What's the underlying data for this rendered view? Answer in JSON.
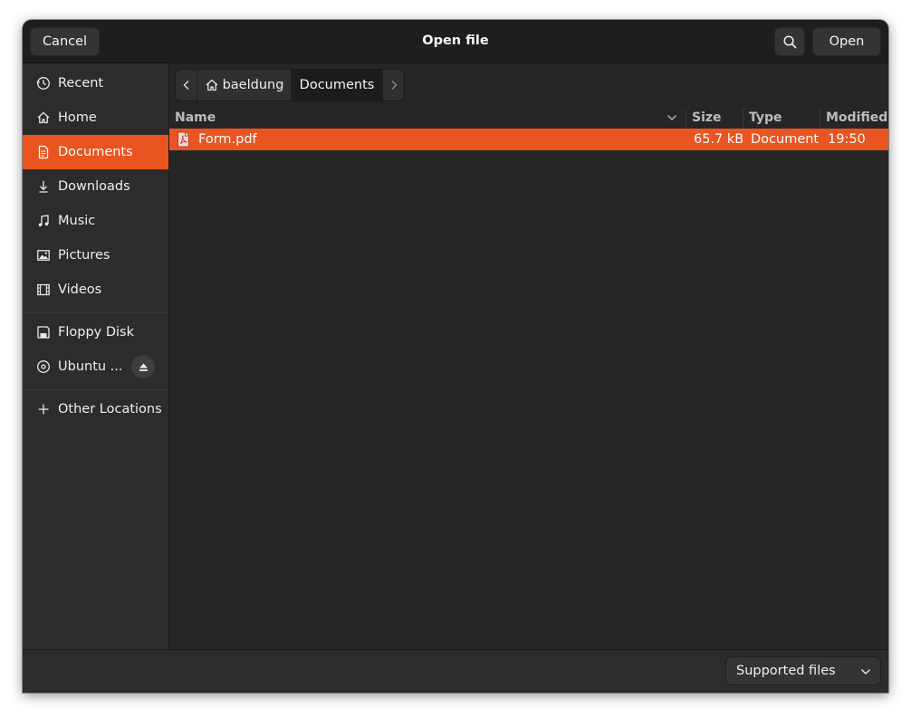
{
  "header": {
    "title": "Open file",
    "cancel_label": "Cancel",
    "open_label": "Open",
    "search_icon": "search-icon"
  },
  "sidebar": {
    "items": [
      {
        "label": "Recent",
        "icon": "clock-icon"
      },
      {
        "label": "Home",
        "icon": "home-icon"
      },
      {
        "label": "Documents",
        "icon": "document-icon",
        "selected": true
      },
      {
        "label": "Downloads",
        "icon": "download-icon"
      },
      {
        "label": "Music",
        "icon": "music-note-icon"
      },
      {
        "label": "Pictures",
        "icon": "picture-icon"
      },
      {
        "label": "Videos",
        "icon": "film-icon"
      }
    ],
    "devices": [
      {
        "label": "Floppy Disk",
        "icon": "drive-icon"
      },
      {
        "label": "Ubuntu ...",
        "icon": "optical-disc-icon",
        "eject_icon": "eject-icon"
      }
    ],
    "other": {
      "label": "Other Locations",
      "icon": "plus-icon"
    }
  },
  "pathbar": {
    "segments": [
      "baeldung",
      "Documents"
    ]
  },
  "columns": {
    "name": "Name",
    "size": "Size",
    "type": "Type",
    "modified": "Modified"
  },
  "files": [
    {
      "name": "Form.pdf",
      "size": "65.7 kB",
      "type": "Document",
      "modified": "19:50",
      "icon": "pdf-file-icon"
    }
  ],
  "footer": {
    "filter_selected": "Supported files"
  },
  "colors": {
    "accent": "#e95420",
    "window_bg": "#2a2a2a",
    "headerbar_bg": "#1e1e1e"
  }
}
